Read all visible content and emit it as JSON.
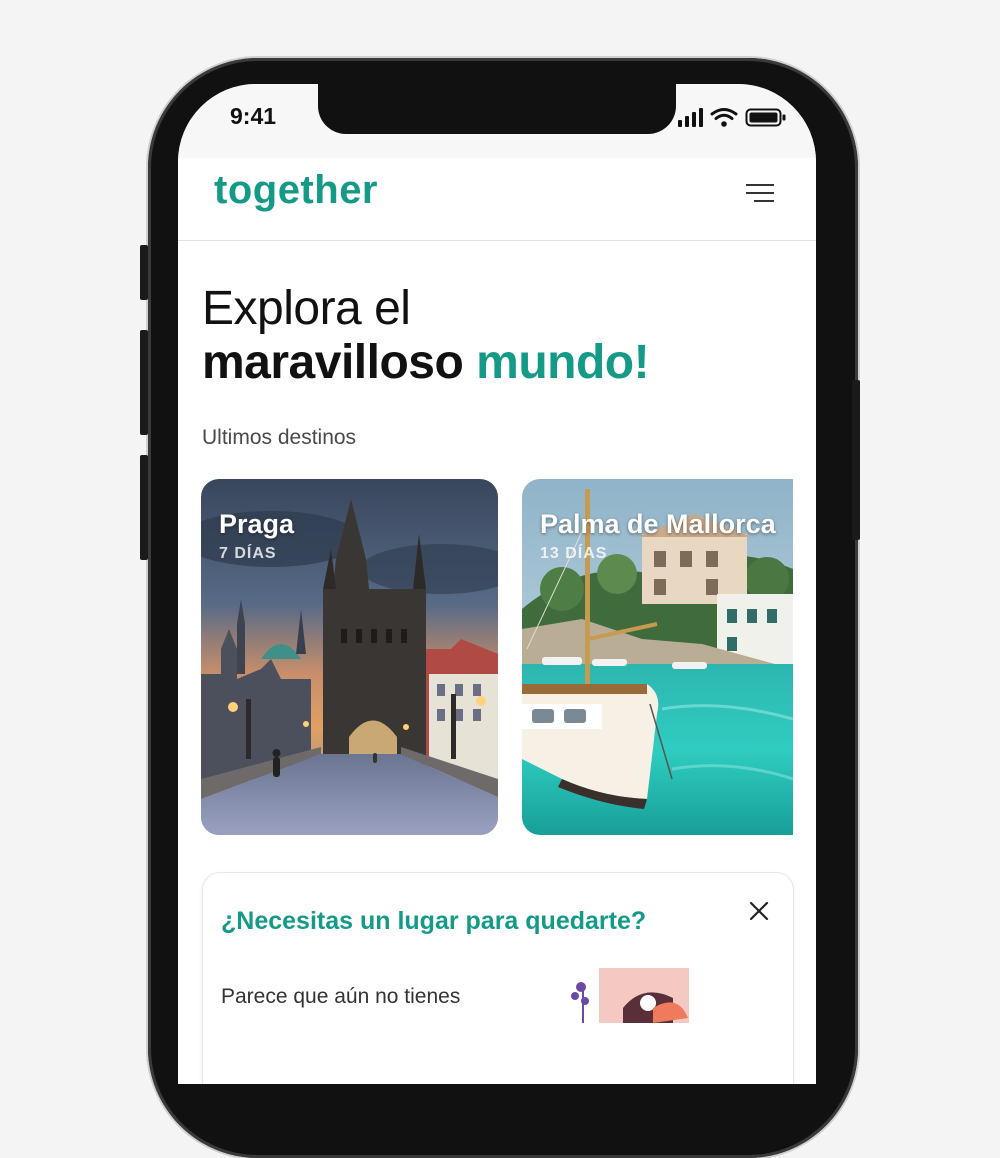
{
  "status_bar": {
    "time": "9:41"
  },
  "header": {
    "logo": "together"
  },
  "hero": {
    "line1": "Explora el",
    "line2_bold": "maravilloso",
    "line2_accent": "mundo!"
  },
  "section": {
    "title": "Ultimos destinos"
  },
  "destinations": [
    {
      "name": "Praga",
      "duration": "7 DÍAS"
    },
    {
      "name": "Palma de Mallorca",
      "duration": "13 DÍAS"
    }
  ],
  "lodging_card": {
    "title": "¿Necesitas un lugar para quedarte?",
    "text": "Parece que aún no tienes"
  },
  "colors": {
    "accent": "#159a88",
    "text": "#111111"
  }
}
